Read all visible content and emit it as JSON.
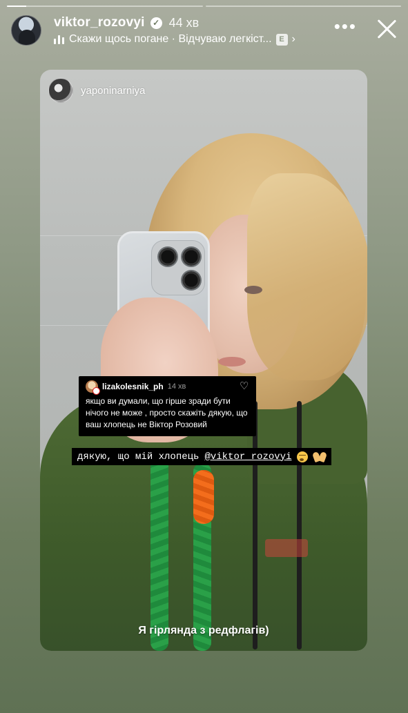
{
  "progress": {
    "segments": [
      {
        "fill": 0.1
      },
      {
        "fill": 0
      }
    ]
  },
  "header": {
    "username": "viktor_rozovyi",
    "verified_glyph": "✓",
    "time": "44 хв",
    "music_text": "Скажи щось погане · Відчуваю легкіст...",
    "explicit_label": "E",
    "chevron": "›",
    "more_glyph": "•••",
    "icons": {
      "verified": "verified-badge-icon",
      "music": "music-bars-icon",
      "close": "close-icon",
      "more": "more-options-icon"
    }
  },
  "card": {
    "username": "yaponinarniya",
    "comment": {
      "username": "lizakolesnik_ph",
      "time": "14 хв",
      "text": "якщо ви думали, що гірше зради бути нічого не може , просто скажіть дякую, що ваш хлопець не Віктор Розовий"
    },
    "caption": {
      "text": "дякую, що мій хлопець",
      "mention": "@viktor_rozovyi",
      "emojis": [
        "face-exhaling-icon",
        "heart-hands-icon"
      ]
    },
    "bottom_text": "Я гірлянда з редфлагів)"
  },
  "colors": {
    "accent_strap": "#2aa048",
    "orange_strap": "#f46d1c",
    "hoodie": "#4e6a34"
  }
}
